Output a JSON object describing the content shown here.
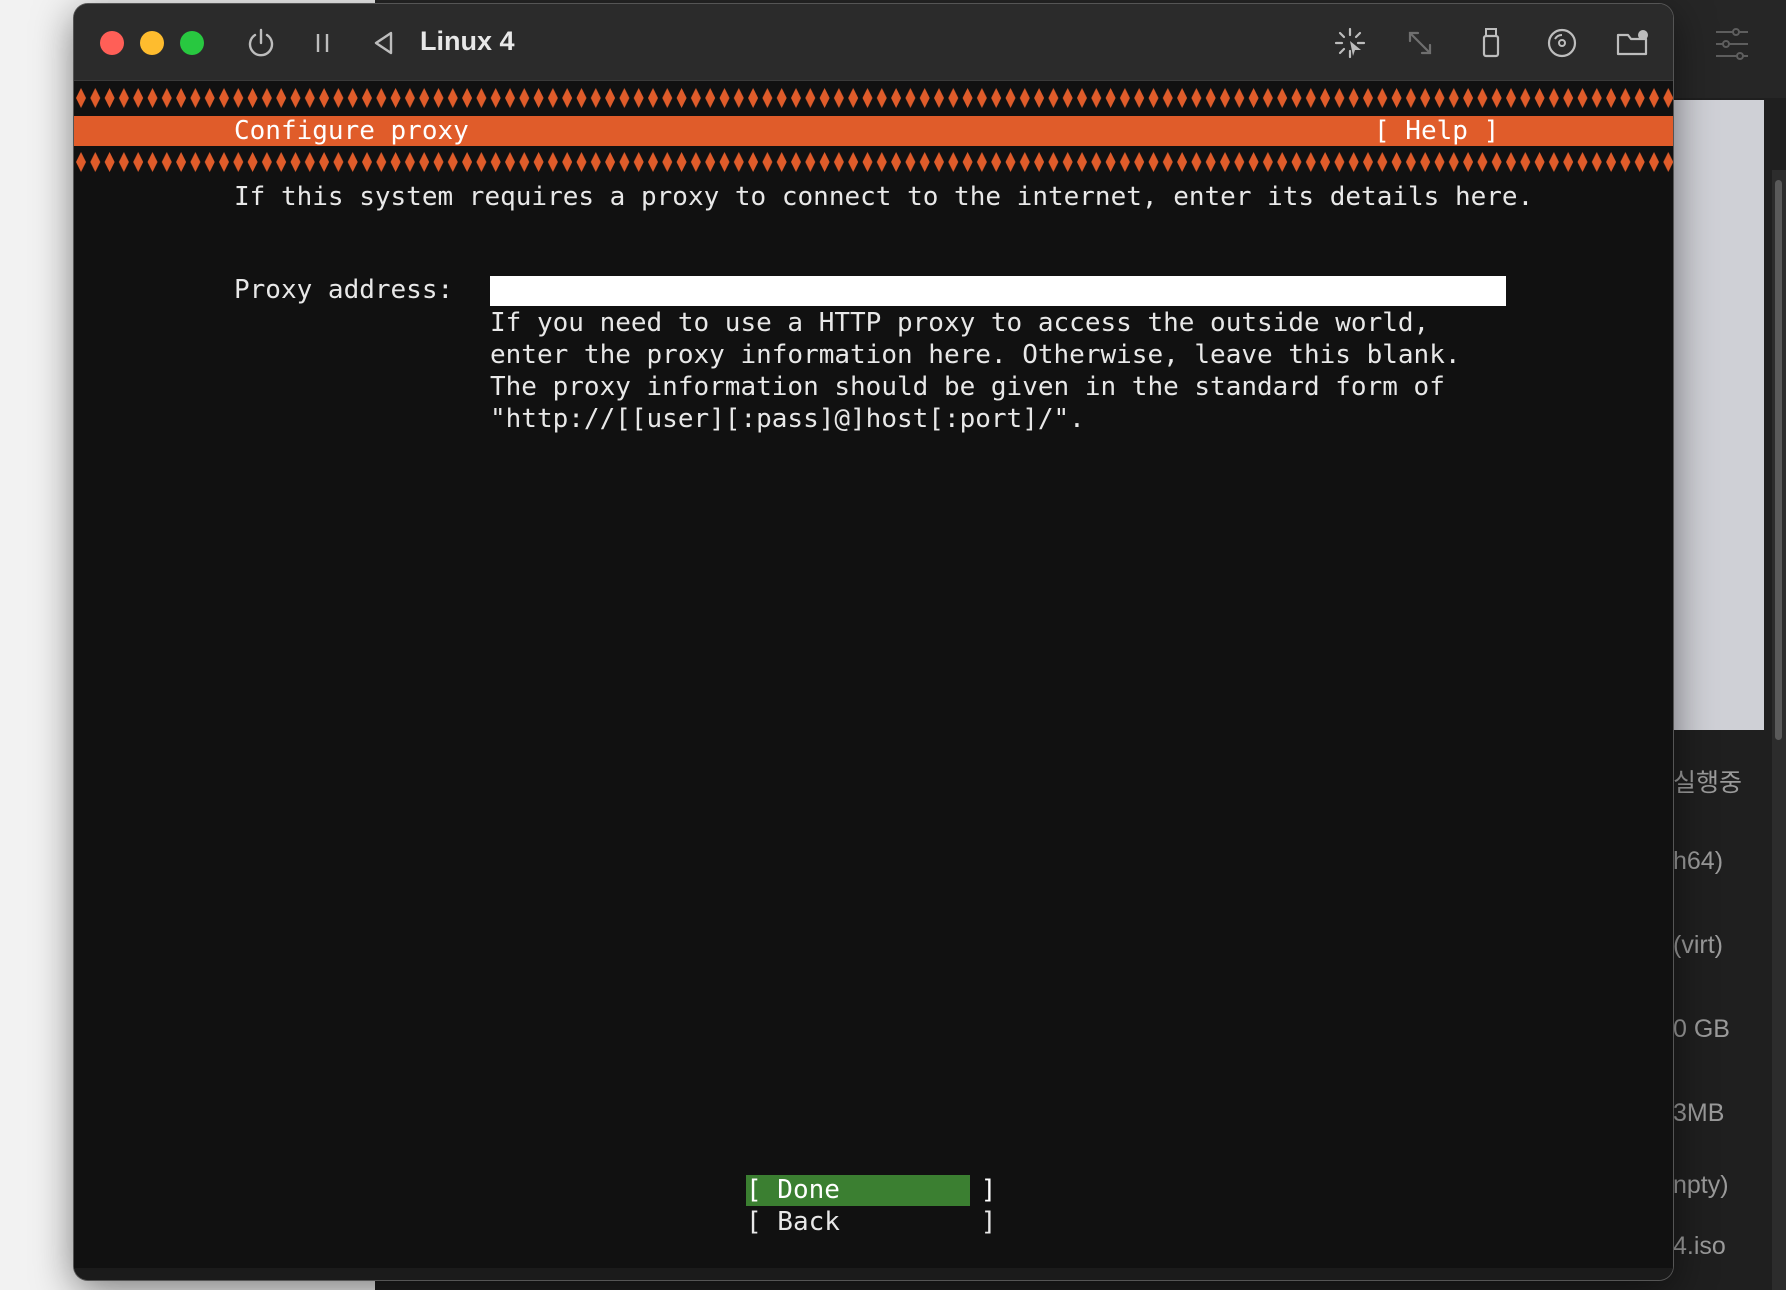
{
  "window": {
    "title": "Linux 4"
  },
  "header": {
    "title": "Configure proxy",
    "help_label": "[ Help ]"
  },
  "intro_text": "If this system requires a proxy to connect to the internet, enter its details here.",
  "proxy": {
    "label": "Proxy address:",
    "value": "",
    "help_line1": "If you need to use a HTTP proxy to access the outside world,",
    "help_line2": "enter the proxy information here. Otherwise, leave this blank.",
    "help_line3": "The proxy information should be given in the standard form of",
    "help_line4": "\"http://[[user][:pass]@]host[:port]/\"."
  },
  "buttons": {
    "done_label": "[ Done         ]",
    "back_label": "[ Back         ]"
  },
  "background_panel": {
    "items": [
      "실행중",
      "h64)",
      "(virt)",
      "0 GB",
      "3MB",
      "npty)",
      "4.iso"
    ]
  },
  "colors": {
    "accent_orange": "#e05c2a",
    "button_green": "#3b7f31",
    "terminal_bg": "#111111"
  },
  "icons": [
    "power-icon",
    "pause-icon",
    "back-icon",
    "capture-cursor-icon",
    "resize-icon",
    "usb-icon",
    "cd-dvd-icon",
    "shared-folder-icon",
    "settings-sliders-icon"
  ]
}
